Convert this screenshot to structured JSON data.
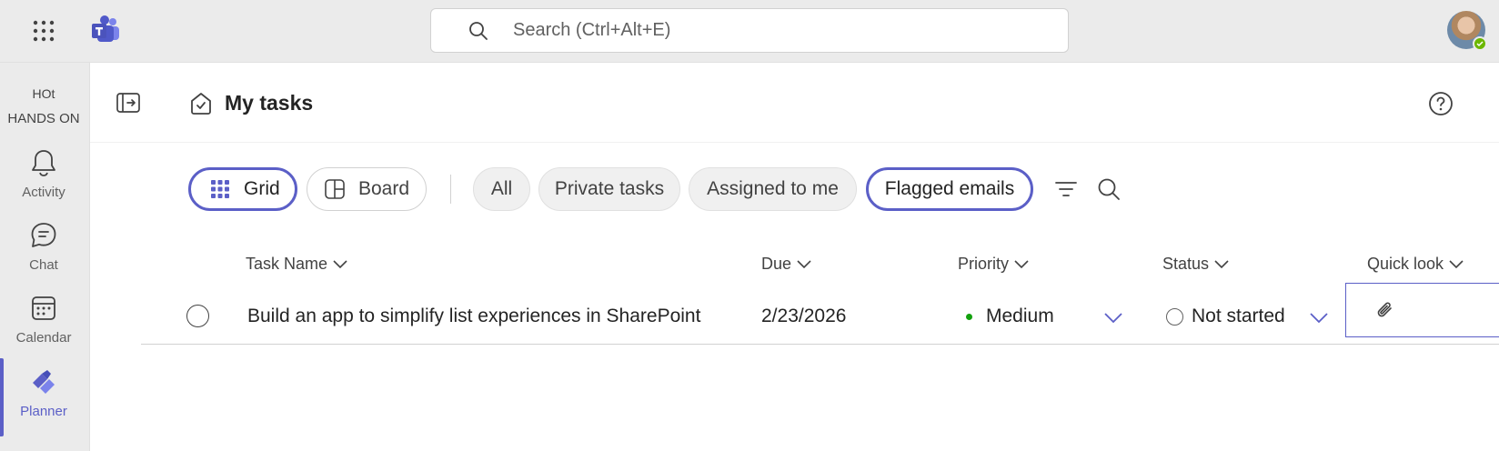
{
  "app": {
    "search_placeholder": "Search (Ctrl+Alt+E)",
    "accent": "#5b5fc7"
  },
  "rail": {
    "org_line1": "HOt",
    "org_line2": "HANDS ON",
    "items": [
      {
        "label": "Activity",
        "icon": "bell-icon"
      },
      {
        "label": "Chat",
        "icon": "chat-icon"
      },
      {
        "label": "Calendar",
        "icon": "calendar-icon"
      },
      {
        "label": "Planner",
        "icon": "planner-icon",
        "active": true
      }
    ]
  },
  "header": {
    "title": "My tasks"
  },
  "toolbar": {
    "views": [
      {
        "label": "Grid",
        "icon": "grid-icon",
        "selected": true
      },
      {
        "label": "Board",
        "icon": "board-icon",
        "selected": false
      }
    ],
    "filters": [
      {
        "label": "All",
        "selected": false
      },
      {
        "label": "Private tasks",
        "selected": false
      },
      {
        "label": "Assigned to me",
        "selected": false
      },
      {
        "label": "Flagged emails",
        "selected": true
      }
    ]
  },
  "grid": {
    "columns": [
      "Task Name",
      "Due",
      "Priority",
      "Status",
      "Quick look"
    ],
    "rows": [
      {
        "task_name": "Build an app to simplify list experiences in SharePoint",
        "due": "2/23/2026",
        "priority": "Medium",
        "priority_color": "#13a10e",
        "status": "Not started"
      }
    ]
  }
}
